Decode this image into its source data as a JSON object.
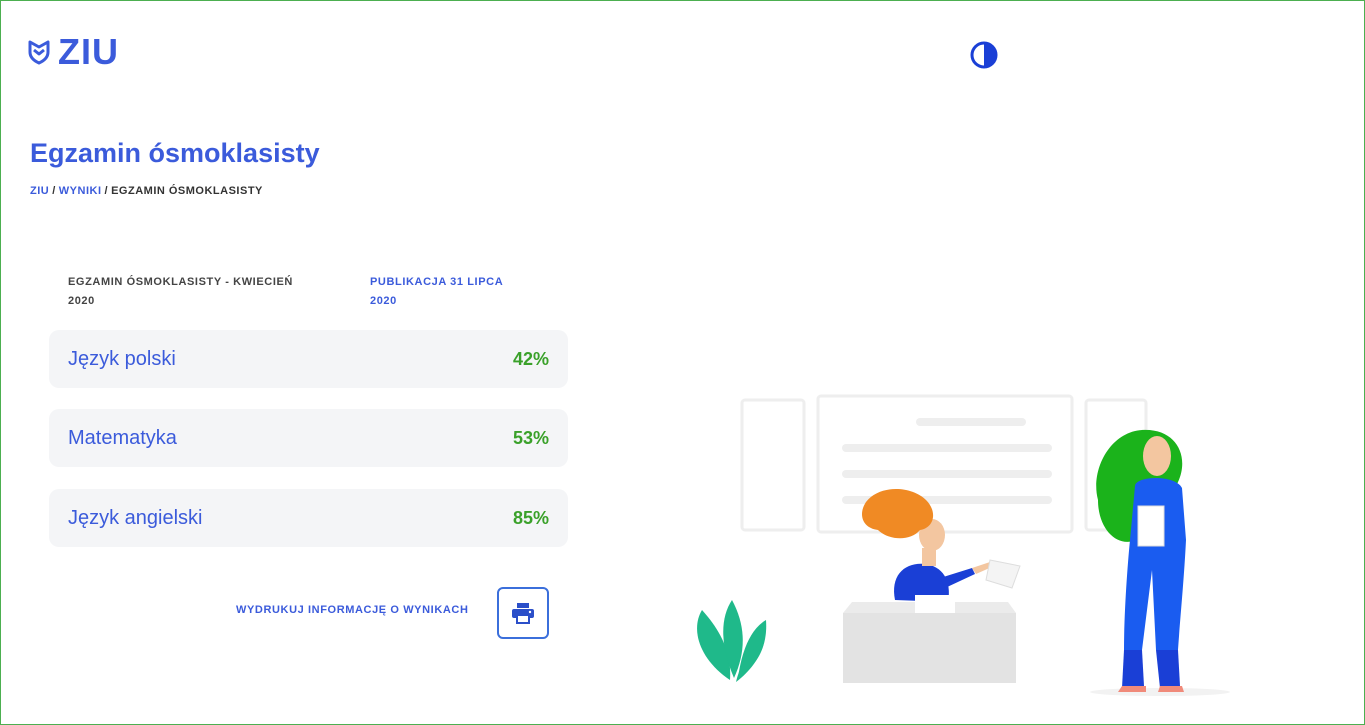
{
  "header": {
    "logo_text": "ZIU",
    "contrast_icon": "contrast-icon"
  },
  "page": {
    "title": "Egzamin ósmoklasisty",
    "breadcrumb": [
      {
        "label": "ZIU",
        "link": true
      },
      {
        "label": "WYNIKI",
        "link": true
      },
      {
        "label": "EGZAMIN ÓSMOKLASISTY",
        "link": false
      }
    ]
  },
  "exam": {
    "name_line1": "EGZAMIN ÓSMOKLASISTY - KWIECIEŃ",
    "name_line2": "2020",
    "publication_line1": "PUBLIKACJA 31 LIPCA",
    "publication_line2": "2020"
  },
  "results": [
    {
      "subject": "Język polski",
      "score": "42%"
    },
    {
      "subject": "Matematyka",
      "score": "53%"
    },
    {
      "subject": "Język angielski",
      "score": "85%"
    }
  ],
  "actions": {
    "print_label": "WYDRUKUJ INFORMACJĘ O WYNIKACH",
    "print_icon": "printer-icon"
  },
  "colors": {
    "accent": "#3b5bdb",
    "score_green": "#3aa12a",
    "card_bg": "#f4f5f7"
  }
}
